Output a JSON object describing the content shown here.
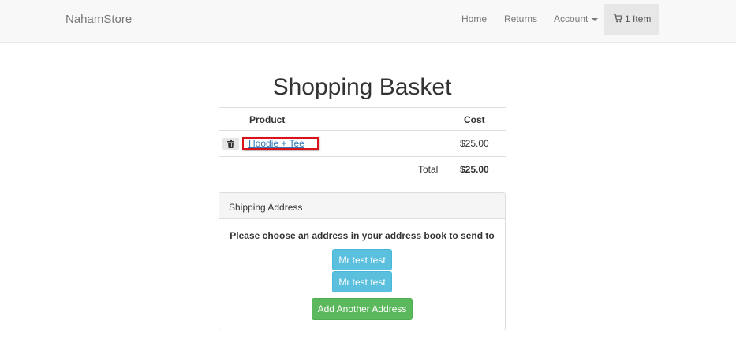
{
  "navbar": {
    "brand": "NahamStore",
    "home": "Home",
    "returns": "Returns",
    "account": "Account",
    "cart": "1 Item"
  },
  "basket": {
    "title": "Shopping Basket",
    "headers": {
      "product": "Product",
      "cost": "Cost"
    },
    "items": [
      {
        "name": "Hoodie + Tee",
        "cost": "$25.00"
      }
    ],
    "total_label": "Total",
    "total_value": "$25.00"
  },
  "shipping": {
    "heading": "Shipping Address",
    "prompt": "Please choose an address in your address book to send to",
    "addresses": [
      "Mr test test",
      "Mr test test"
    ],
    "add_button": "Add Another Address"
  },
  "colors": {
    "highlight": "#d9121b",
    "info": "#5bc0de",
    "success": "#5cb85c",
    "link": "#337ab7"
  }
}
